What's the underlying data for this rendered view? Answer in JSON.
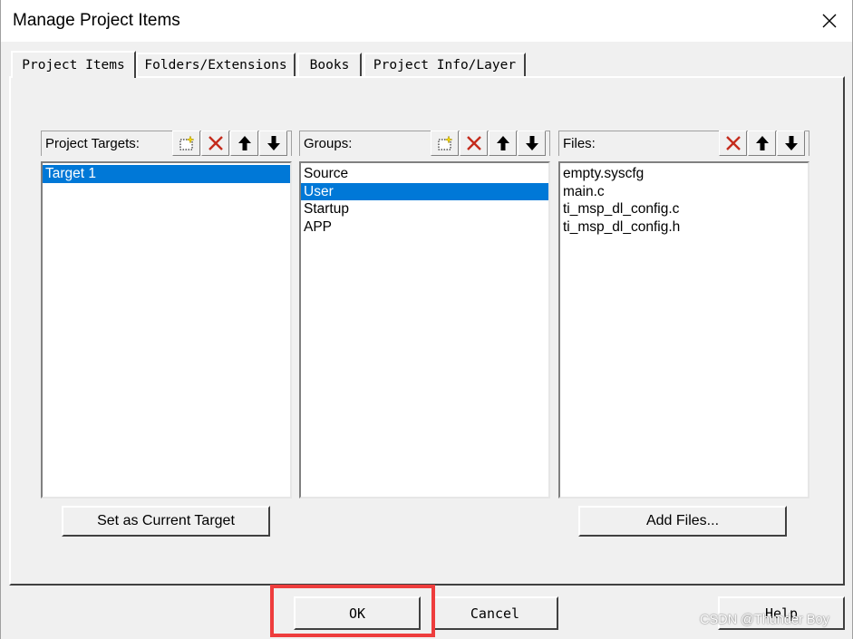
{
  "window": {
    "title": "Manage Project Items",
    "close_icon": "close-icon"
  },
  "tabs": [
    {
      "label": "Project Items",
      "active": true
    },
    {
      "label": "Folders/Extensions",
      "active": false
    },
    {
      "label": "Books",
      "active": false
    },
    {
      "label": "Project Info/Layer",
      "active": false
    }
  ],
  "targets": {
    "header": "Project Targets:",
    "items": [
      {
        "label": "Target 1",
        "selected": true
      }
    ],
    "toolbar": [
      "new-item-icon",
      "delete-icon",
      "move-up-icon",
      "move-down-icon"
    ]
  },
  "groups": {
    "header": "Groups:",
    "items": [
      {
        "label": "Source",
        "selected": false
      },
      {
        "label": "User",
        "selected": true
      },
      {
        "label": "Startup",
        "selected": false
      },
      {
        "label": "APP",
        "selected": false
      }
    ],
    "toolbar": [
      "new-item-icon",
      "delete-icon",
      "move-up-icon",
      "move-down-icon"
    ]
  },
  "files": {
    "header": "Files:",
    "items": [
      {
        "label": "empty.syscfg",
        "selected": false
      },
      {
        "label": "main.c",
        "selected": false
      },
      {
        "label": "ti_msp_dl_config.c",
        "selected": false
      },
      {
        "label": "ti_msp_dl_config.h",
        "selected": false
      }
    ],
    "toolbar": [
      "delete-icon",
      "move-up-icon",
      "move-down-icon"
    ]
  },
  "buttons": {
    "set_current_target": "Set as Current Target",
    "add_files": "Add Files...",
    "ok": "OK",
    "cancel": "Cancel",
    "help": "Help"
  },
  "watermark": "CSDN @Thunder Boy",
  "colors": {
    "selection": "#0078d7",
    "highlight_box": "#ee3d3d",
    "delete_icon": "#c42b1c"
  }
}
